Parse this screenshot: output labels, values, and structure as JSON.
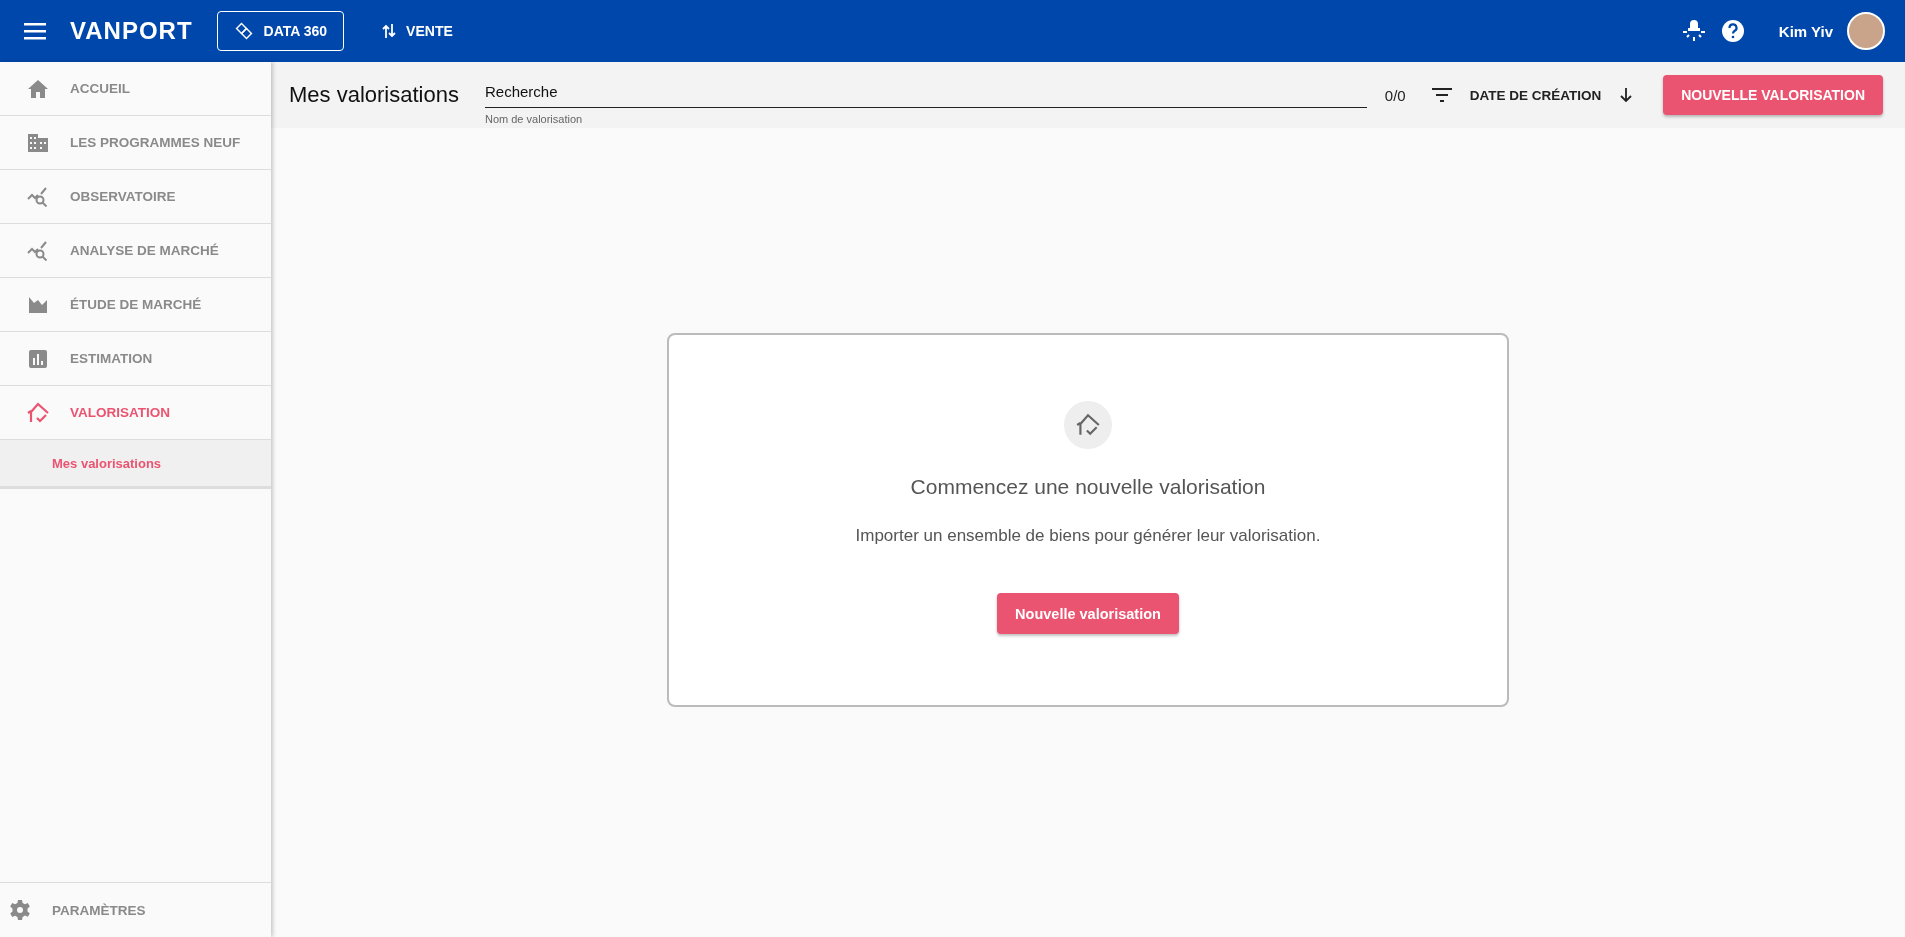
{
  "header": {
    "logo": "VANPORT",
    "product_button": "DATA 360",
    "mode_button": "VENTE",
    "user_name": "Kim Yiv"
  },
  "sidebar": {
    "items": [
      {
        "label": "ACCUEIL",
        "selected": false
      },
      {
        "label": "LES PROGRAMMES NEUF",
        "selected": false
      },
      {
        "label": "OBSERVATOIRE",
        "selected": false
      },
      {
        "label": "ANALYSE DE MARCHÉ",
        "selected": false
      },
      {
        "label": "ÉTUDE DE MARCHÉ",
        "selected": false
      },
      {
        "label": "ESTIMATION",
        "selected": false
      },
      {
        "label": "VALORISATION",
        "selected": true,
        "children": [
          {
            "label": "Mes valorisations",
            "selected": true
          }
        ]
      }
    ],
    "footer": "PARAMÈTRES"
  },
  "toolbar": {
    "title": "Mes valorisations",
    "search": {
      "value": "Recherche",
      "hint": "Nom de valorisation"
    },
    "count": "0/0",
    "sort": "DATE DE CRÉATION",
    "new_button": "NOUVELLE VALORISATION"
  },
  "empty_state": {
    "title": "Commencez une nouvelle valorisation",
    "text": "Importer un ensemble de biens pour générer leur valorisation.",
    "button": "Nouvelle valorisation"
  }
}
